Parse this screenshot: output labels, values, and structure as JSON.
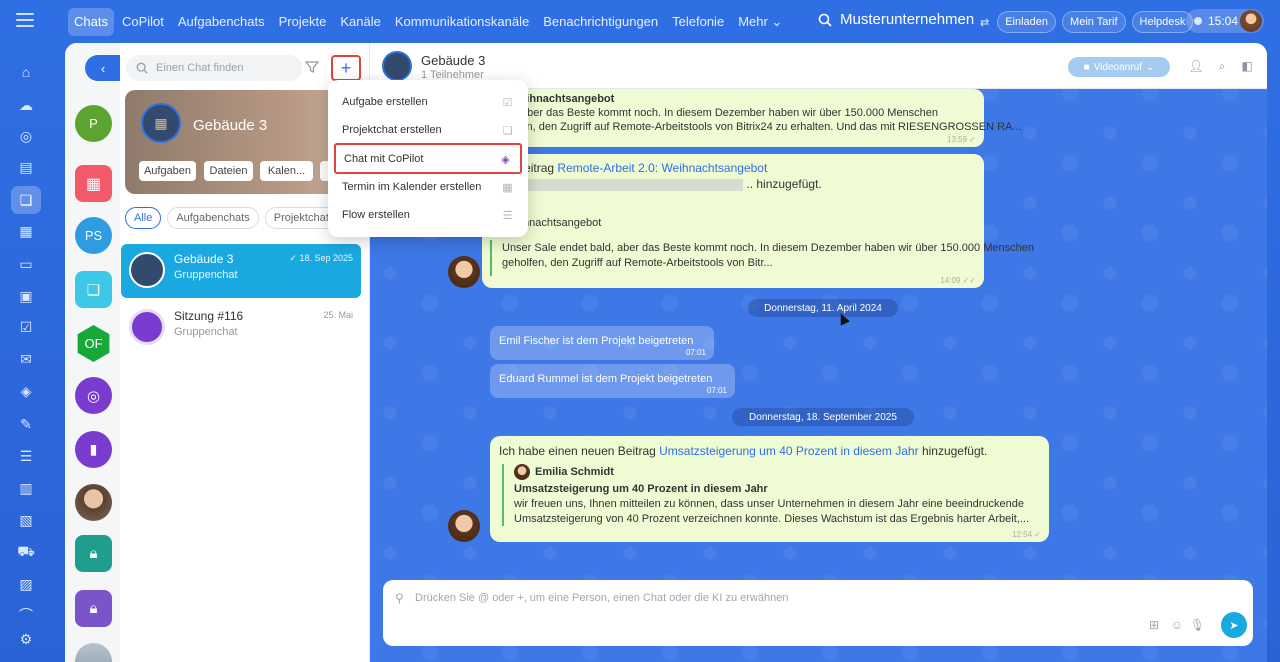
{
  "topnav": {
    "items": [
      "Chats",
      "CoPilot",
      "Aufgabenchats",
      "Projekte",
      "Kanäle",
      "Kommunikationskanäle",
      "Benachrichtigungen",
      "Telefonie",
      "Mehr ⌄"
    ],
    "company": "Musterunternehmen",
    "invite": "Einladen",
    "tariff": "Mein Tarif",
    "helpdesk": "Helpdesk",
    "time": "15:04"
  },
  "rail2": {
    "p_initial": "P",
    "ps_initial": "PS",
    "of_initial": "OF"
  },
  "chatlist": {
    "search_placeholder": "Einen Chat finden",
    "card": {
      "title": "Gebäude 3",
      "buttons": [
        "Aufgaben",
        "Dateien",
        "Kalen..."
      ]
    },
    "tabs": [
      "Alle",
      "Aufgabenchats",
      "Projektchats"
    ],
    "rows": [
      {
        "name": "Gebäude 3",
        "sub": "Gruppenchat",
        "date": "✓ 18. Sep 2025"
      },
      {
        "name": "Sitzung #116",
        "sub": "Gruppenchat",
        "date": "25. Mai"
      }
    ]
  },
  "dropdown": {
    "items": [
      {
        "label": "Aufgabe erstellen",
        "icon": "task-icon"
      },
      {
        "label": "Projektchat erstellen",
        "icon": "chat-icon"
      },
      {
        "label": "Chat mit CoPilot",
        "icon": "copilot-icon"
      },
      {
        "label": "Termin im Kalender erstellen",
        "icon": "calendar-icon"
      },
      {
        "label": "Flow erstellen",
        "icon": "flow-icon"
      }
    ]
  },
  "chathead": {
    "title": "Gebäude 3",
    "subtitle": "1 Teilnehmer",
    "video_label": "Videoanruf"
  },
  "messages": {
    "m1": {
      "title": "2.0: Weihnachtsangebot",
      "line1": "t bald, aber das Beste kommt noch. In diesem Dezember haben wir über 150.000 Menschen",
      "line2": "zu helfen, den Zugriff auf Remote-Arbeitstools von Bitrix24 zu erhalten. Und das mit RIESENGROSSEN RA...",
      "time": "13:59 ✓"
    },
    "m2": {
      "pre": "euen Beitrag",
      "link": "Remote-Arbeit 2.0: Weihnachtsangebot",
      "line2_link": "bitr",
      "line2_suffix": ".. hinzugefügt.",
      "author": "midt",
      "quote_title": "0: Weihnachtsangebot",
      "quote_line1": "Unser Sale endet bald, aber das Beste kommt noch. In diesem Dezember haben wir über 150.000 Menschen",
      "quote_line2": "geholfen, den Zugriff auf Remote-Arbeitstools von Bitr...",
      "time": "14:09 ✓✓"
    },
    "date1": "Donnerstag, 11. April 2024",
    "sys1": {
      "text": "Emil Fischer ist dem Projekt beigetreten",
      "time": "07:01"
    },
    "sys2": {
      "text": "Eduard Rummel ist dem Projekt beigetreten",
      "time": "07:01"
    },
    "date2": "Donnerstag, 18. September 2025",
    "m3": {
      "pre": "Ich habe einen neuen Beitrag",
      "link": "Umsatzsteigerung um 40 Prozent in diesem Jahr",
      "post": "hinzugefügt.",
      "author": "Emilia Schmidt",
      "quote_title": "Umsatzsteigerung um 40 Prozent in diesem Jahr",
      "quote_line1": "wir freuen uns, Ihnen mitteilen zu können, dass unser Unternehmen in diesem Jahr eine beeindruckende",
      "quote_line2": "Umsatzsteigerung von 40 Prozent verzeichnen konnte. Dieses Wachstum ist das Ergebnis harter Arbeit,...",
      "time": "12:54 ✓"
    }
  },
  "composer": {
    "placeholder": "Drücken Sie @ oder +, um eine Person, einen Chat oder die KI zu erwähnen"
  },
  "colors": {
    "accent": "#2f6fe4",
    "highlight": "#e0443c",
    "active_row": "#19a8e0",
    "bubble": "#eefbd3"
  }
}
